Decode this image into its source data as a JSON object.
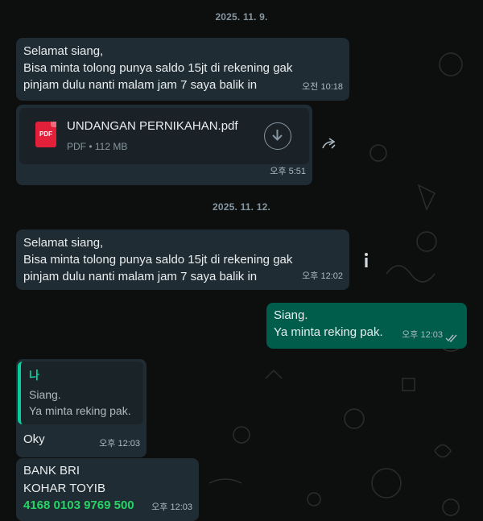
{
  "dates": [
    "2025. 11. 9.",
    "2025. 11. 12."
  ],
  "messages": {
    "m1": {
      "text": "Selamat siang,\nBisa minta tolong punya saldo 15jt di rekening gak\npinjam dulu nanti malam jam 7 saya balik in",
      "time": "오전 10:18"
    },
    "file": {
      "name": "UNDANGAN PERNIKAHAN.pdf",
      "meta": "PDF • 112 MB",
      "time": "오후 5:51",
      "icon_label": "PDF"
    },
    "m2": {
      "text": "Selamat siang,\nBisa minta tolong punya saldo 15jt di rekening gak\npinjam dulu nanti malam jam 7 saya balik in",
      "time": "오후 12:02"
    },
    "m3": {
      "text": "Siang.\nYa minta reking pak.",
      "time": "오후 12:03"
    },
    "m4": {
      "quote_author": "나",
      "quote_text": "Siang.\nYa minta reking pak.",
      "text": "Oky",
      "time": "오후 12:03"
    },
    "m5": {
      "line1": "BANK BRI",
      "line2": "KOHAR TOYIB",
      "account": "4168 0103 9769 500",
      "time": "오후 12:03"
    }
  },
  "colors": {
    "incoming_bubble": "#202c33",
    "outgoing_bubble": "#005c4b",
    "quote_accent": "#06cf9c",
    "link_green": "#25d366",
    "read_tick": "#53bdeb"
  },
  "icons": [
    "forward-icon",
    "download-icon",
    "info-icon",
    "double-check-icon",
    "pdf-file-icon"
  ]
}
